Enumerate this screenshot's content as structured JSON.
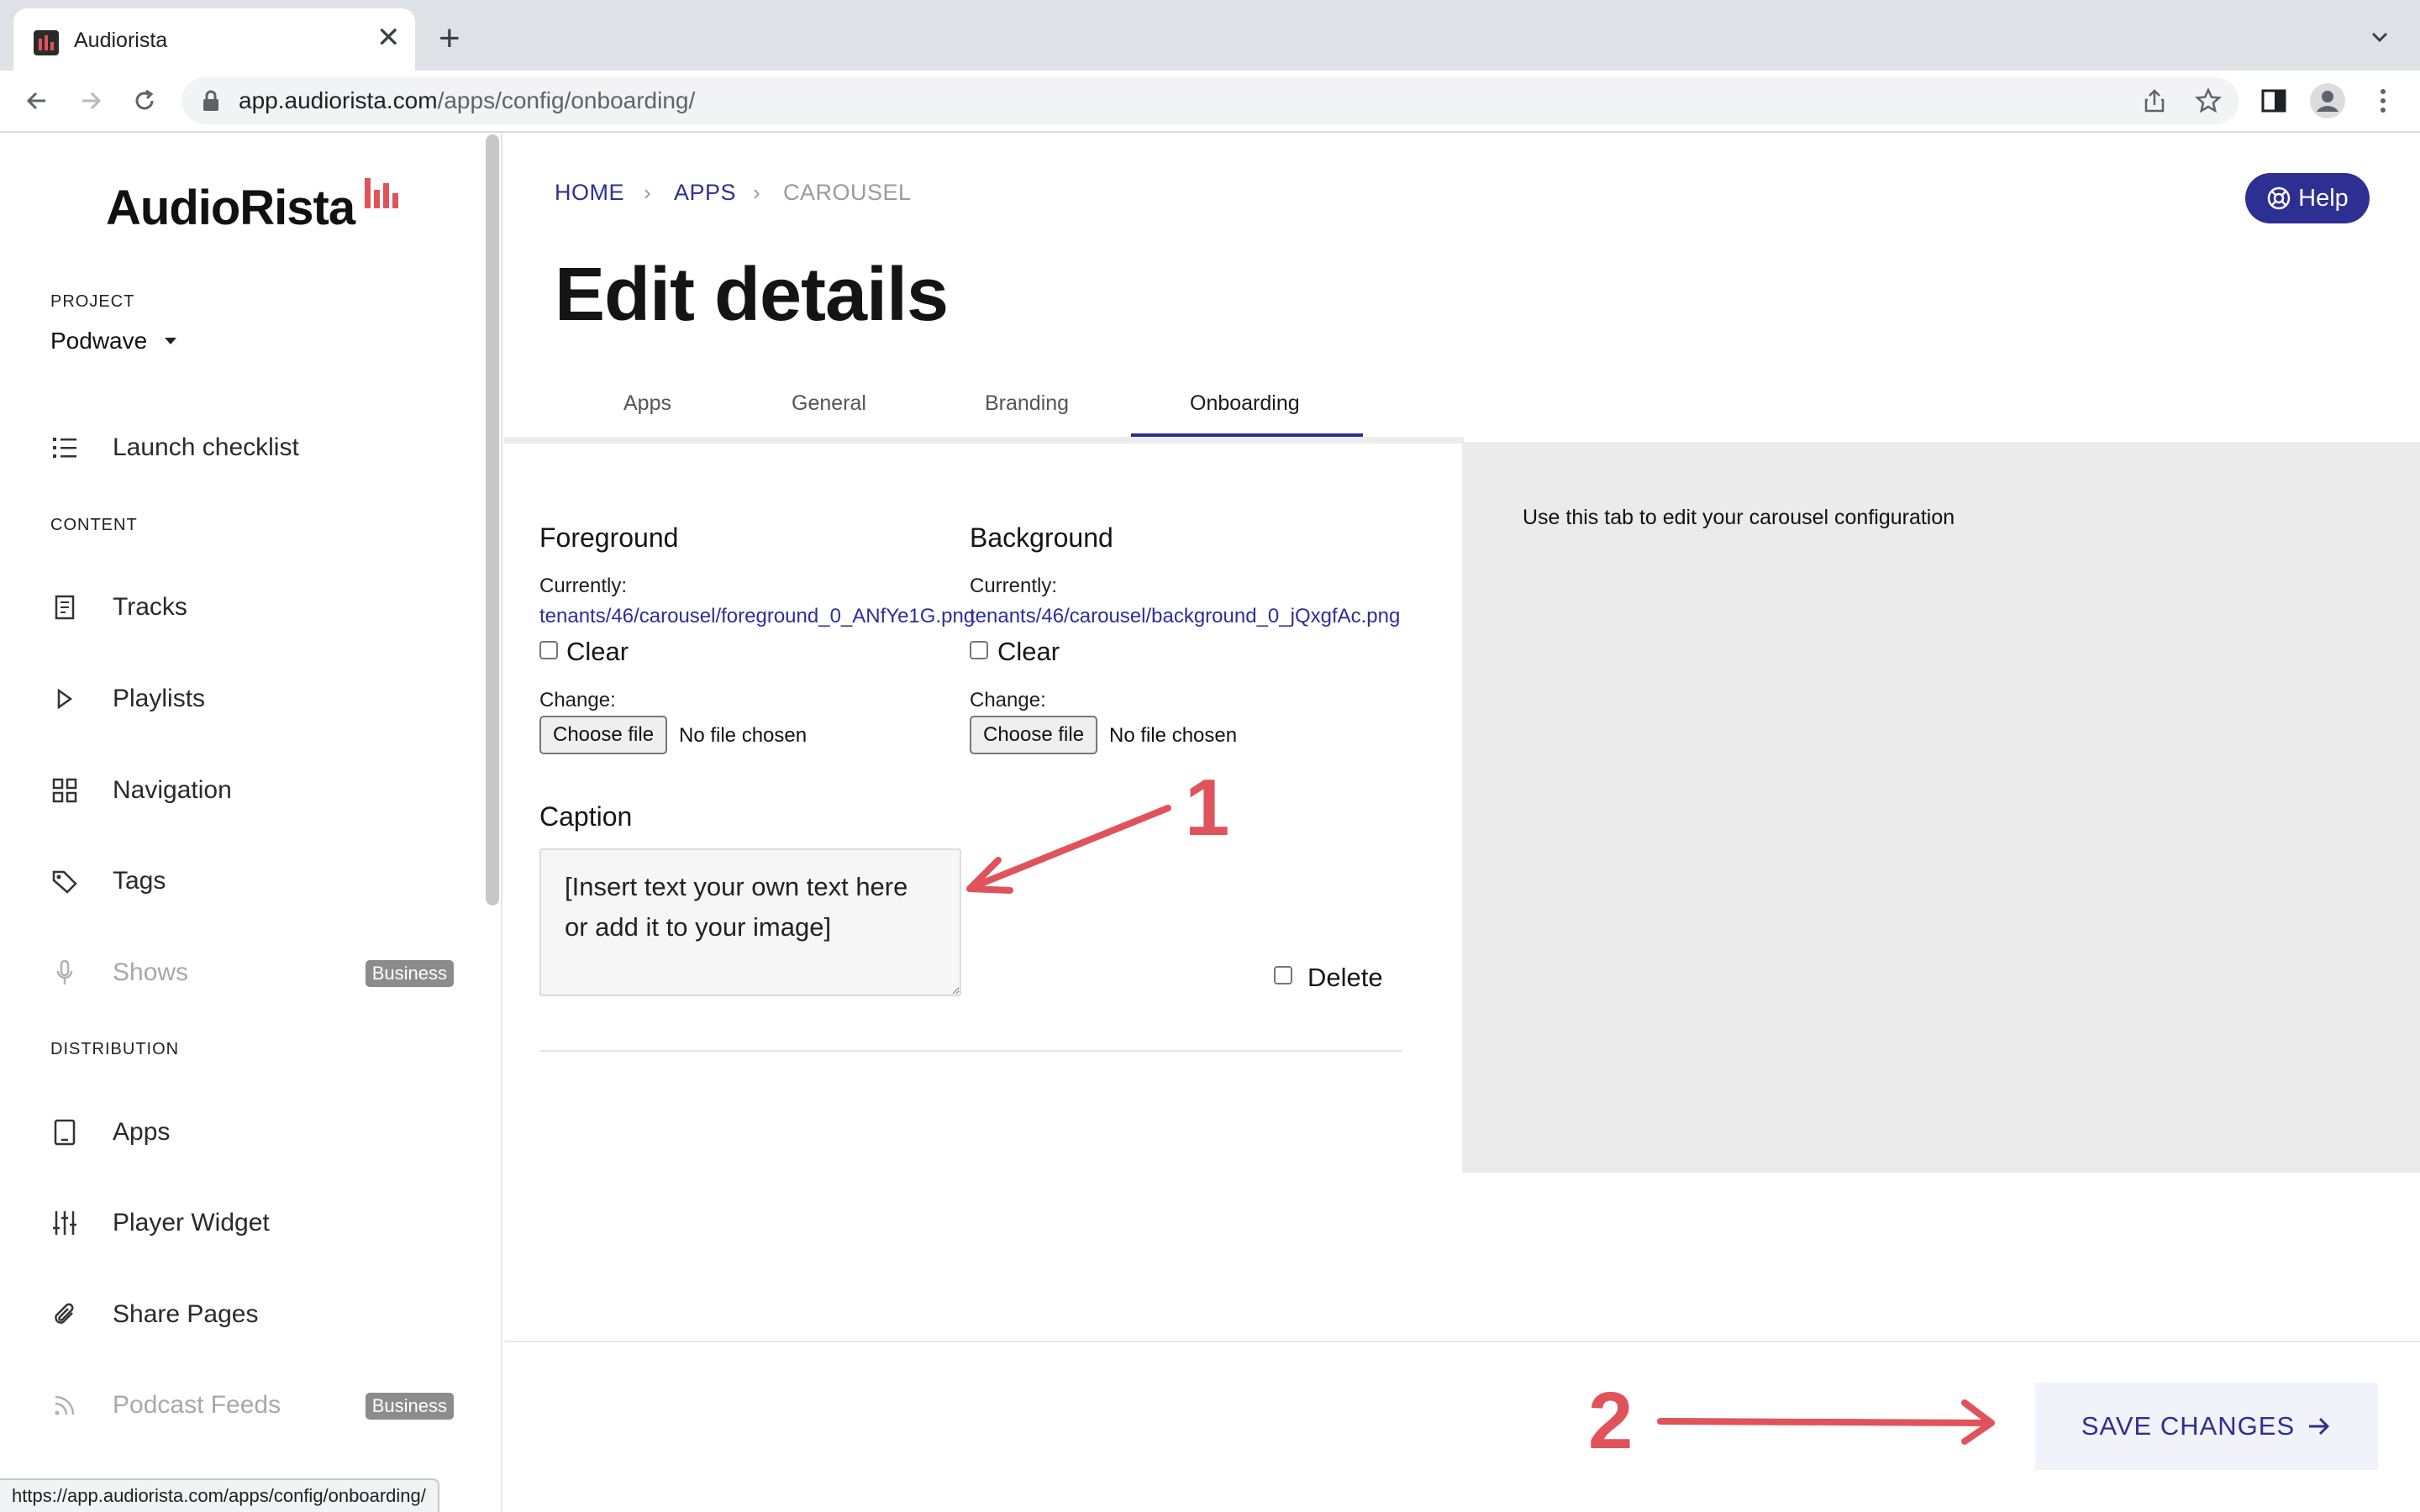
{
  "browser": {
    "tab_title": "Audiorista",
    "url_host": "app.audiorista.com",
    "url_path": "/apps/config/onboarding/",
    "status_url": "https://app.audiorista.com/apps/config/onboarding/"
  },
  "sidebar": {
    "logo": "AudioRista",
    "project_label": "PROJECT",
    "project_name": "Podwave",
    "launch_checklist": "Launch checklist",
    "content_label": "CONTENT",
    "content_items": [
      {
        "label": "Tracks",
        "icon": "document-icon"
      },
      {
        "label": "Playlists",
        "icon": "play-icon"
      },
      {
        "label": "Navigation",
        "icon": "grid-icon"
      },
      {
        "label": "Tags",
        "icon": "tag-icon"
      },
      {
        "label": "Shows",
        "icon": "microphone-icon",
        "badge": "Business",
        "disabled": true
      }
    ],
    "distribution_label": "DISTRIBUTION",
    "distribution_items": [
      {
        "label": "Apps",
        "icon": "tablet-icon"
      },
      {
        "label": "Player Widget",
        "icon": "sliders-icon"
      },
      {
        "label": "Share Pages",
        "icon": "paperclip-icon"
      },
      {
        "label": "Podcast Feeds",
        "icon": "rss-icon",
        "badge": "Business",
        "disabled": true
      }
    ]
  },
  "breadcrumb": [
    "HOME",
    "APPS",
    "CAROUSEL"
  ],
  "help_label": "Help",
  "page_title": "Edit details",
  "tabs": [
    "Apps",
    "General",
    "Branding",
    "Onboarding"
  ],
  "active_tab": "Onboarding",
  "form": {
    "foreground": {
      "title": "Foreground",
      "currently_label": "Currently:",
      "file": "tenants/46/carousel/foreground_0_ANfYe1G.png",
      "clear_label": "Clear",
      "change_label": "Change:",
      "choose_label": "Choose file",
      "no_file": "No file chosen"
    },
    "background": {
      "title": "Background",
      "currently_label": "Currently:",
      "file": "tenants/46/carousel/background_0_jQxgfAc.png",
      "clear_label": "Clear",
      "change_label": "Change:",
      "choose_label": "Choose file",
      "no_file": "No file chosen"
    },
    "caption_label": "Caption",
    "caption_value": "[Insert text your own text here or add it to your image]",
    "delete_label": "Delete"
  },
  "info_text": "Use this tab to edit your carousel configuration",
  "save_label": "SAVE CHANGES",
  "annotations": [
    "1",
    "2"
  ],
  "colors": {
    "accent": "#2e2f93",
    "annotation": "#e0535a",
    "brand": "#e0535a"
  }
}
